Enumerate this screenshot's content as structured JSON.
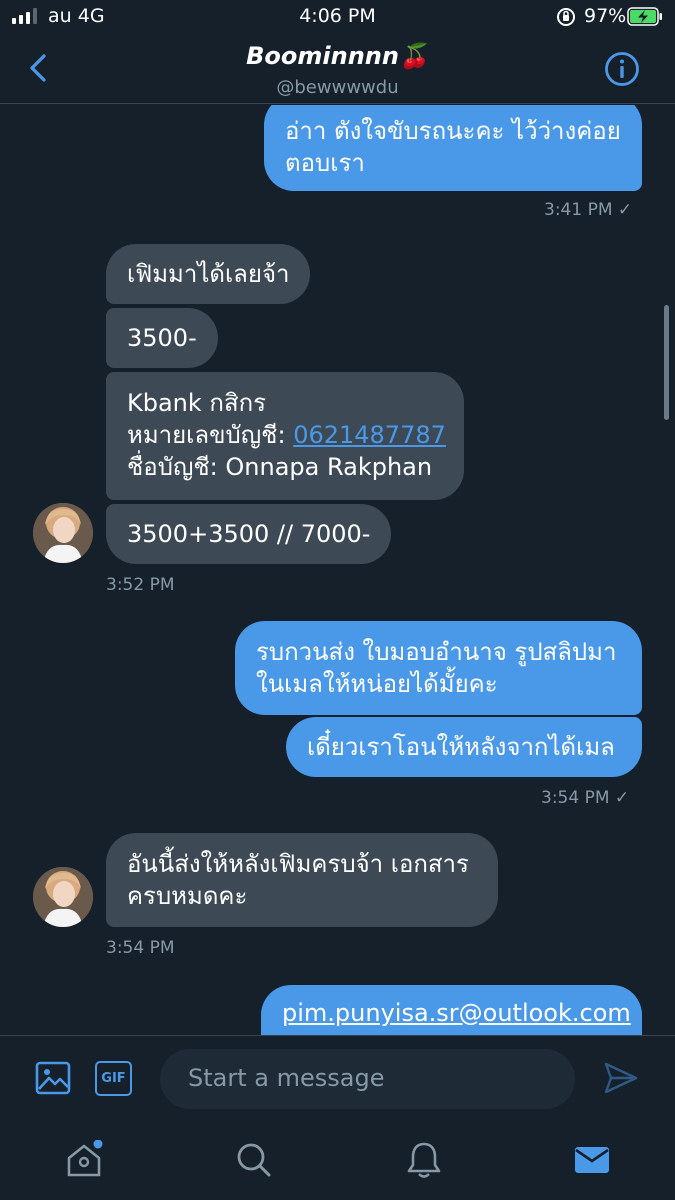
{
  "status_bar": {
    "carrier": "au 4G",
    "time": "4:06 PM",
    "battery_percent": "97%"
  },
  "header": {
    "name": "Boominnnn🍒",
    "handle": "@bewwwwdu"
  },
  "messages": [
    {
      "direction": "out",
      "text_lines": [
        "อ่าา ตังใจขับรถนะคะ ไว้ว่างค่อย",
        "ตอบเรา"
      ]
    },
    {
      "direction": "out",
      "timestamp": "3:41 PM ✓"
    },
    {
      "direction": "in",
      "text": "เฟิมมาได้เลยจ้า"
    },
    {
      "direction": "in",
      "text": "3500-"
    },
    {
      "direction": "in",
      "line1": "Kbank กสิกร",
      "line2_label": "หมายเลขบัญชี: ",
      "line2_link": "0621487787",
      "line3": "ชื่อบัญชี: Onnapa  Rakphan"
    },
    {
      "direction": "in",
      "text": "3500+3500 // 7000-"
    },
    {
      "direction": "in",
      "timestamp": "3:52 PM"
    },
    {
      "direction": "out",
      "text_lines": [
        "รบกวนส่ง ใบมอบอำนาจ รูปสลิปมา",
        "ในเมลให้หน่อยได้มั้ยคะ"
      ]
    },
    {
      "direction": "out",
      "text": "เดี๋ยวเราโอนให้หลังจากได้เมล"
    },
    {
      "direction": "out",
      "timestamp": "3:54 PM ✓"
    },
    {
      "direction": "in",
      "text_lines": [
        "อันนี้ส่งให้หลังเฟิมครบจ้า เอกสาร",
        "ครบหมดคะ"
      ]
    },
    {
      "direction": "in",
      "timestamp": "3:54 PM"
    },
    {
      "direction": "out",
      "text": "pim.punyisa.sr@outlook.com"
    }
  ],
  "composer": {
    "placeholder": "Start a message",
    "gif_label": "GIF"
  },
  "tabs": [
    "home-icon",
    "search-icon",
    "notifications-icon",
    "messages-icon"
  ],
  "colors": {
    "background": "#15202b",
    "outgoing_bubble": "#4a99e9",
    "incoming_bubble": "#3d4a56",
    "muted_text": "#8899a6",
    "accent": "#4a99e9"
  }
}
